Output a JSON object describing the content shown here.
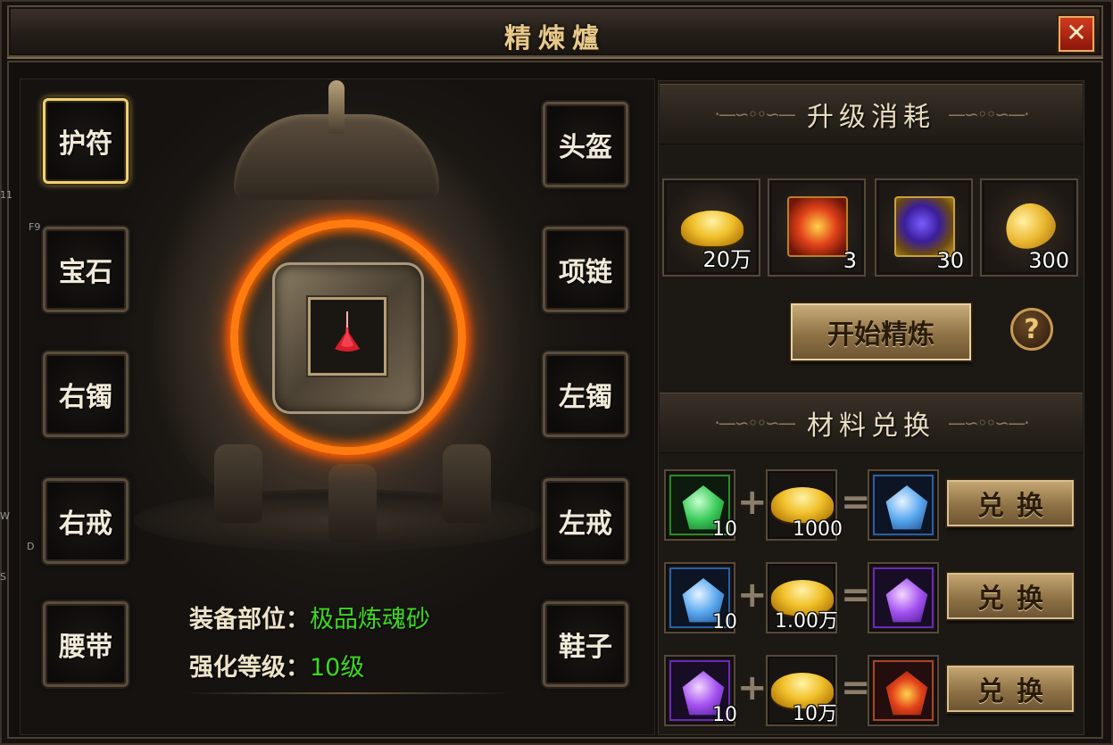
{
  "window": {
    "title": "精煉爐",
    "close_label": "✕"
  },
  "equipment_slots": [
    {
      "label": "护符",
      "selected": true
    },
    {
      "label": "宝石",
      "selected": false
    },
    {
      "label": "右镯",
      "selected": false
    },
    {
      "label": "右戒",
      "selected": false
    },
    {
      "label": "腰带",
      "selected": false
    },
    {
      "label": "头盔",
      "selected": false
    },
    {
      "label": "项链",
      "selected": false
    },
    {
      "label": "左镯",
      "selected": false
    },
    {
      "label": "左戒",
      "selected": false
    },
    {
      "label": "鞋子",
      "selected": false
    }
  ],
  "info": {
    "part_label": "装备部位：",
    "part_value": "极品炼魂砂",
    "level_label": "强化等级：",
    "level_value": "10级"
  },
  "upgrade_cost": {
    "title": "升级消耗",
    "items": [
      {
        "icon": "gold-ingot-icon",
        "qty": "20万"
      },
      {
        "icon": "red-crystal-icon",
        "qty": "3"
      },
      {
        "icon": "purple-ore-icon",
        "qty": "30"
      },
      {
        "icon": "gold-leaf-icon",
        "qty": "300"
      }
    ]
  },
  "start_button": "开始精炼",
  "help_button": "?",
  "exchange": {
    "title": "材料兑换",
    "button_label": "兑换",
    "rows": [
      {
        "input_icon": "green-gem-icon",
        "input_qty": "10",
        "gold_qty": "1000",
        "output_icon": "blue-gem-icon"
      },
      {
        "input_icon": "blue-gem-icon",
        "input_qty": "10",
        "gold_qty": "1.00万",
        "output_icon": "purple-gem-icon"
      },
      {
        "input_icon": "purple-gem-icon",
        "input_qty": "10",
        "gold_qty": "10万",
        "output_icon": "red-crystal-icon"
      }
    ]
  },
  "side_tags": [
    "11",
    "F9",
    "W",
    "D",
    "S"
  ],
  "colors": {
    "accent_gold": "#e8c98a",
    "value_green": "#3cd91c",
    "fire": "#ff7b10"
  }
}
